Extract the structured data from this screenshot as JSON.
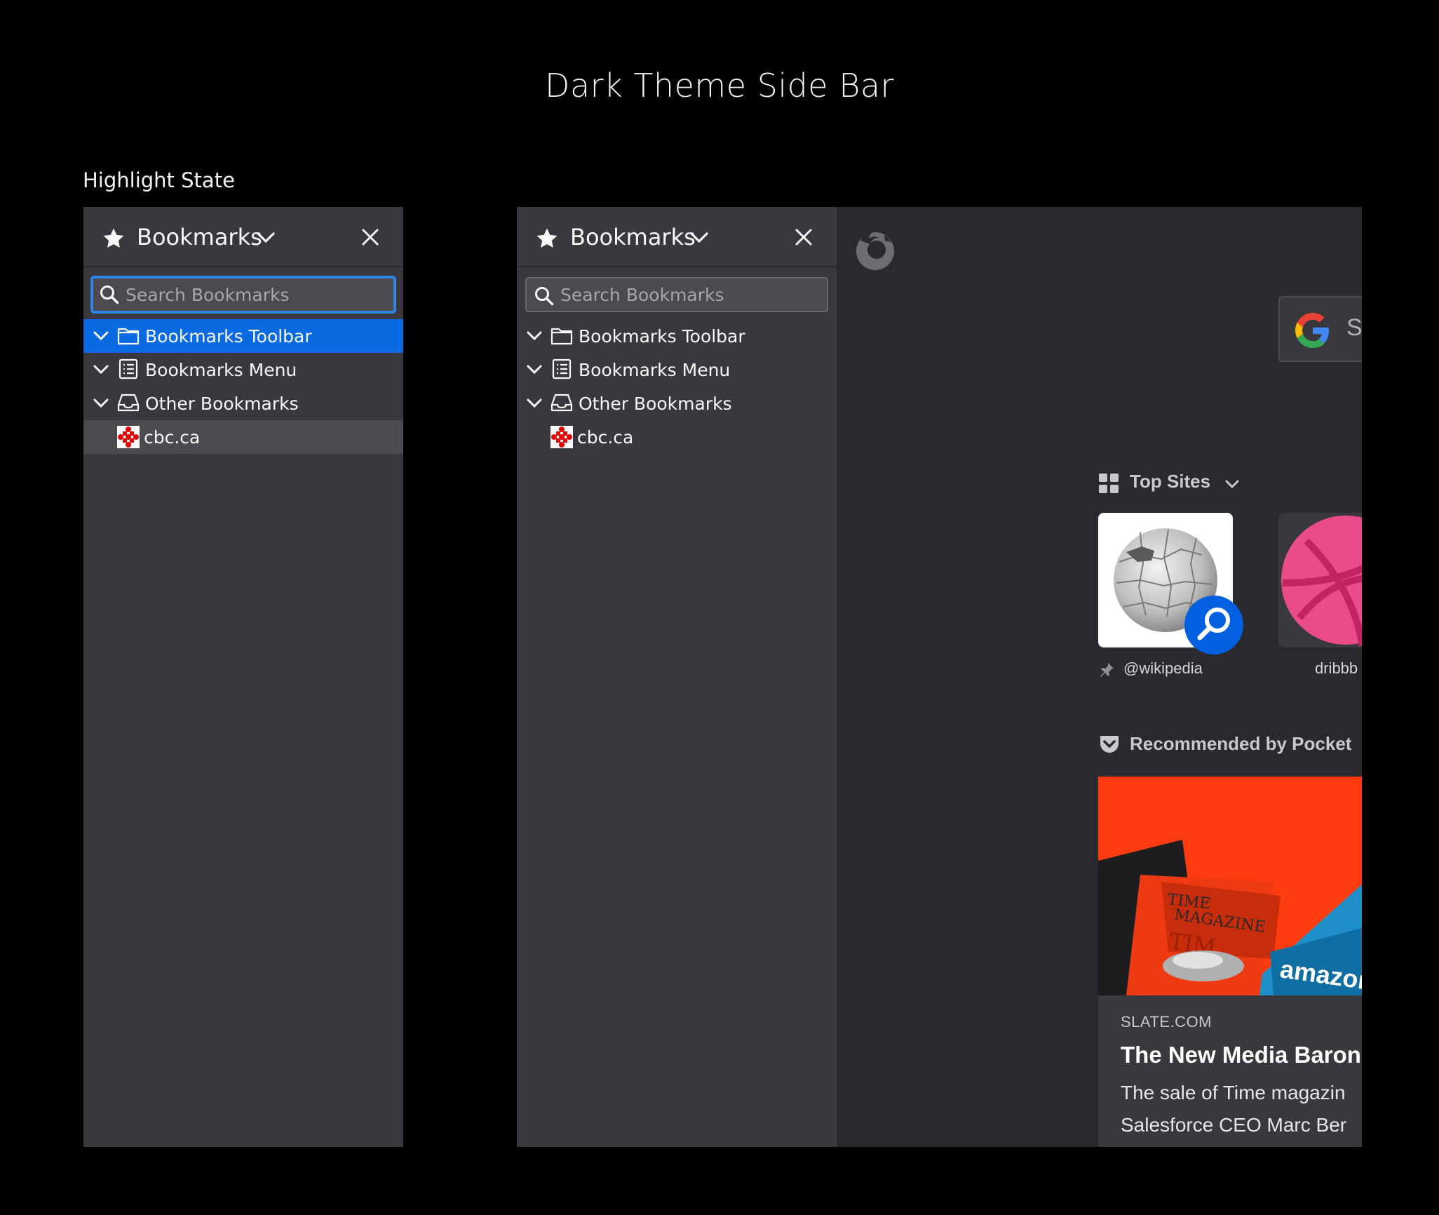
{
  "page": {
    "title": "Dark Theme Side Bar",
    "section_label": "Highlight State"
  },
  "sidebars": [
    {
      "variant": "highlight",
      "header_title": "Bookmarks",
      "search_placeholder": "Search Bookmarks",
      "search_focused": true,
      "items": [
        {
          "label": "Bookmarks Toolbar",
          "icon": "folder-icon",
          "expandable": true,
          "state": "selected"
        },
        {
          "label": "Bookmarks Menu",
          "icon": "bookmarks-menu-icon",
          "expandable": true,
          "state": "normal"
        },
        {
          "label": "Other Bookmarks",
          "icon": "other-bookmarks-icon",
          "expandable": true,
          "state": "normal"
        },
        {
          "label": "cbc.ca",
          "icon": "cbc-favicon-icon",
          "expandable": false,
          "state": "hover"
        }
      ]
    },
    {
      "variant": "default",
      "header_title": "Bookmarks",
      "search_placeholder": "Search Bookmarks",
      "search_focused": false,
      "items": [
        {
          "label": "Bookmarks Toolbar",
          "icon": "folder-icon",
          "expandable": true,
          "state": "normal"
        },
        {
          "label": "Bookmarks Menu",
          "icon": "bookmarks-menu-icon",
          "expandable": true,
          "state": "normal"
        },
        {
          "label": "Other Bookmarks",
          "icon": "other-bookmarks-icon",
          "expandable": true,
          "state": "normal"
        },
        {
          "label": "cbc.ca",
          "icon": "cbc-favicon-icon",
          "expandable": false,
          "state": "normal"
        }
      ]
    }
  ],
  "newtab": {
    "search_partial_text": "Se",
    "top_sites_heading": "Top Sites",
    "top_sites": [
      {
        "label": "@wikipedia",
        "pinned": true
      },
      {
        "label": "dribbb",
        "pinned": false
      }
    ],
    "pocket_heading": "Recommended by Pocket",
    "story": {
      "source": "SLATE.COM",
      "title": "The New Media Baron",
      "description_lines": [
        "The sale of Time magazin",
        "Salesforce CEO Marc Ber"
      ],
      "image_text": [
        "TIME",
        "MAGAZINE",
        "TIM",
        "amazon"
      ]
    }
  },
  "colors": {
    "background": "#000000",
    "sidebar_bg": "#38383d",
    "content_bg": "#2a2a2e",
    "selected_row": "#0a6ae2",
    "hover_row": "#4a4a4f",
    "focus_ring": "#2e86ea"
  }
}
